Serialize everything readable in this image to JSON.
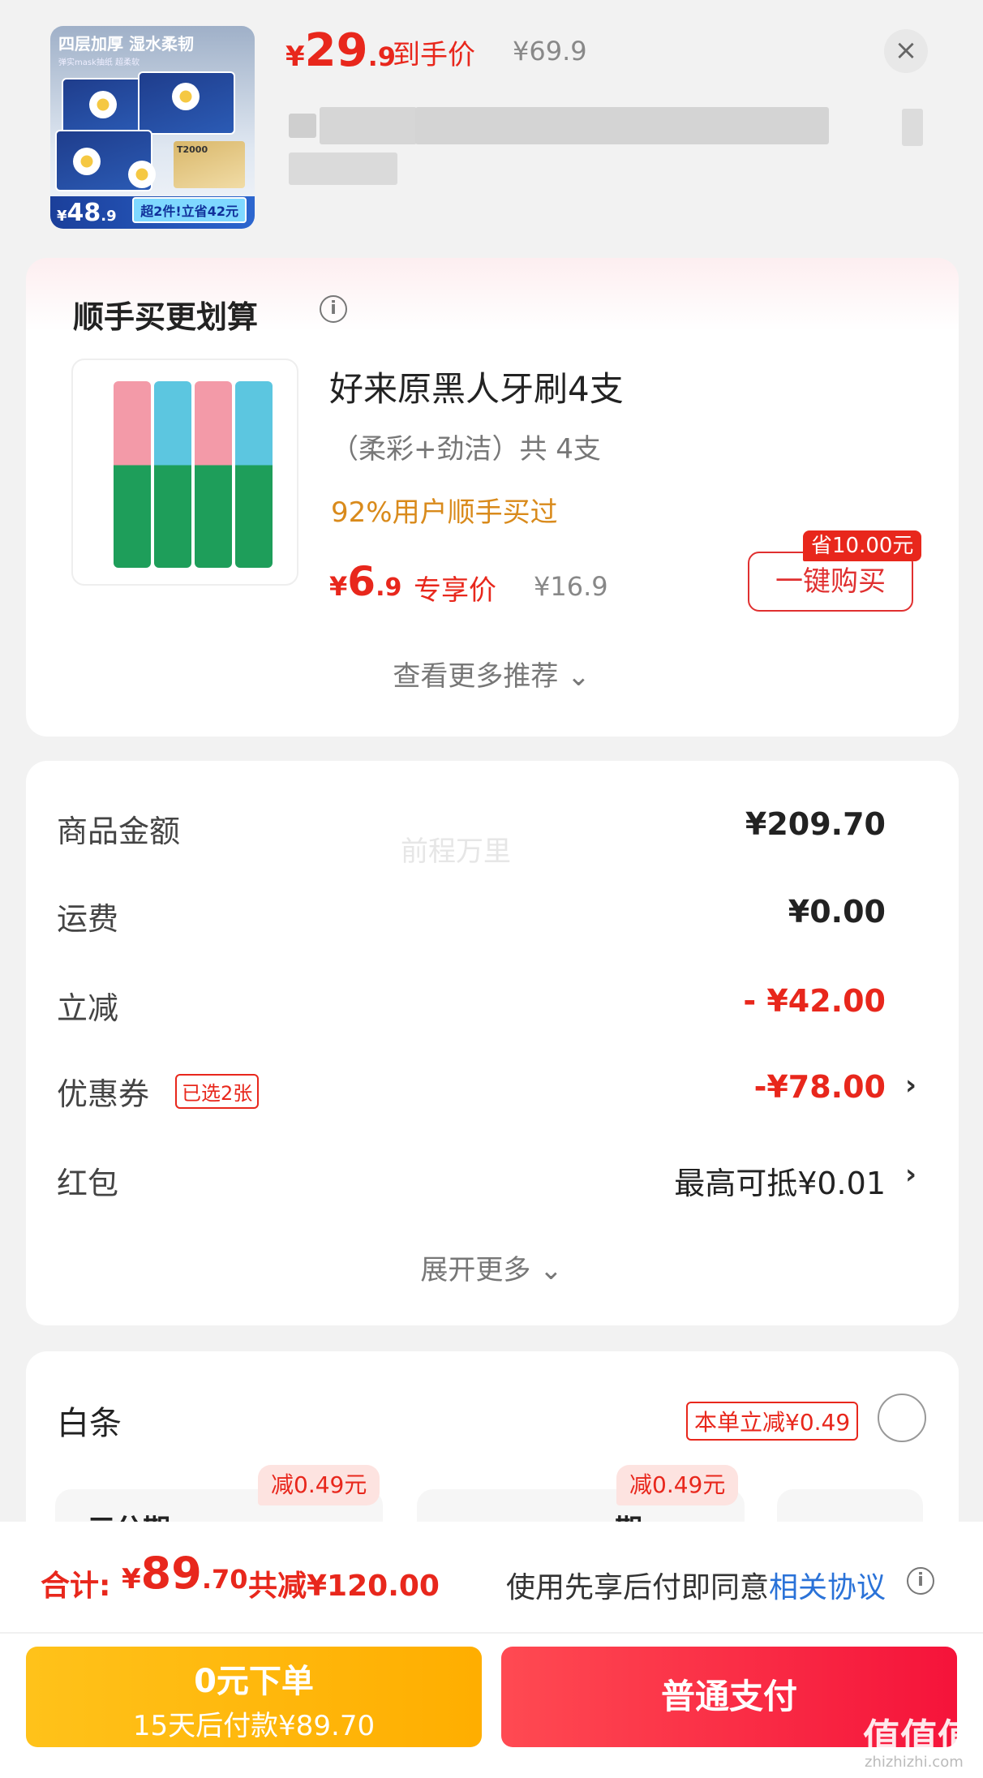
{
  "header": {
    "product_image": {
      "top_text": "四层加厚 湿水柔韧",
      "sub_text": "弹实mask抽纸 超柔软",
      "box_text": "T2000",
      "band_price_yen": "¥",
      "band_price_int": "48",
      "band_price_dec": ".9",
      "band_tag": "超2件!立省42元"
    },
    "price_yen": "¥",
    "price_int": "29",
    "price_dec": ".9",
    "price_label": "到手价",
    "original_price": "¥69.9",
    "close_icon": "close-icon"
  },
  "recommend": {
    "title": "顺手买更划算",
    "item": {
      "name": "好来原黑人牙刷4支",
      "spec": "（柔彩+劲洁）共 4支",
      "social_proof": "92%用户顺手买过",
      "price_yen": "¥",
      "price_int": "6",
      "price_dec": ".9",
      "price_label": "专享价",
      "original_price": "¥16.9",
      "save_tag": "省10.00元",
      "buy_label": "一键购买"
    },
    "more_label": "查看更多推荐 ⌄"
  },
  "summary": {
    "watermark": "前程万里",
    "rows": [
      {
        "label": "商品金额",
        "value": "¥209.70"
      },
      {
        "label": "运费",
        "value": "¥0.00"
      },
      {
        "label": "立减",
        "value": "- ¥42.00"
      },
      {
        "label": "优惠券",
        "value": "-¥78.00",
        "badge": "已选2张"
      },
      {
        "label": "红包",
        "value": "最高可抵¥0.01"
      }
    ],
    "chevron": "›",
    "expand_label": "展开更多 ⌄"
  },
  "baitiao": {
    "label": "白条",
    "tag": "本单立减¥0.49",
    "plans": [
      {
        "tag": "减0.49元",
        "text": "三分期"
      },
      {
        "tag": "减0.49元",
        "text": "期"
      }
    ]
  },
  "footer": {
    "total_label": "合计:",
    "total_yen": "¥",
    "total_int": "89",
    "total_dec": ".70",
    "total_saved": "共减¥120.00",
    "agree_text": "使用先享后付即同意",
    "agree_link": "相关协议",
    "btn_bnpl_line1": "0元下单",
    "btn_bnpl_line2": "15天后付款¥89.70",
    "btn_pay": "普通支付",
    "corner_mark": "值值值",
    "corner_sub": "zhizhizhi.com"
  },
  "colors": {
    "accent_red": "#e8271c",
    "link_blue": "#2a72d8",
    "bnpl_yellow": "#ffb40a",
    "pay_red": "#f5133a"
  }
}
